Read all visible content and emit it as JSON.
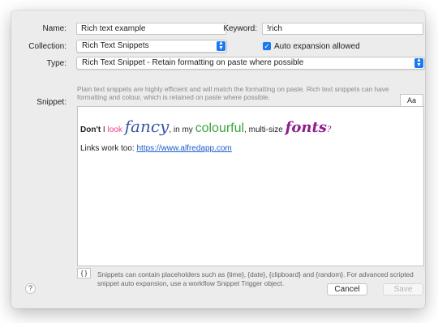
{
  "labels": {
    "name": "Name:",
    "keyword": "Keyword:",
    "collection": "Collection:",
    "type": "Type:",
    "snippet": "Snippet:"
  },
  "fields": {
    "name_value": "Rich text example",
    "keyword_value": "!rich",
    "collection_value": "Rich Text Snippets",
    "type_value": "Rich Text Snippet -  Retain formatting on paste where possible"
  },
  "auto_expansion": {
    "label": "Auto expansion allowed",
    "checked": true
  },
  "help_text": "Plain text snippets are highly efficient and will match the formatting on paste. Rich text snippets can have formatting and colour, which is retained on paste where possible.",
  "aa_label": "Aa",
  "snippet": {
    "w_dont": "Don't",
    "w_i": " I ",
    "w_look": "look",
    "w_fancy": "fancy",
    "w_inmy": ", in my ",
    "w_colourful": "colourful",
    "w_multisize": ", multi-size ",
    "w_fonts": "fonts",
    "w_qm": "?",
    "links_prefix": "Links work too: ",
    "link_url": "https://www.alfredapp.com"
  },
  "braces_label": "{ }",
  "footer_text": "Snippets can contain placeholders such as {time}, {date}, {clipboard} and {random}. For advanced scripted snippet auto expansion, use a workflow Snippet Trigger object.",
  "help_button": "?",
  "buttons": {
    "cancel": "Cancel",
    "save": "Save"
  },
  "colors": {
    "accent": "#1a78f0",
    "pink": "#e83e8c",
    "green": "#3fa442",
    "purple": "#8e1e8a",
    "link": "#1a5cc8"
  },
  "icons": {
    "checkbox": "checkmark-icon",
    "popup": "up-down-chevron-icon",
    "help": "question-icon"
  }
}
